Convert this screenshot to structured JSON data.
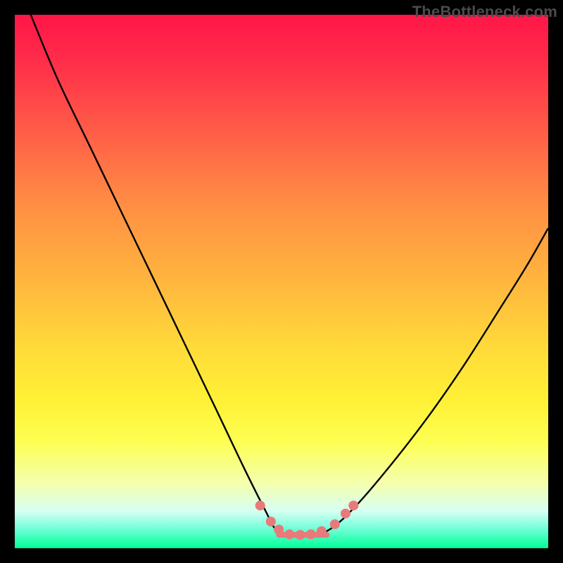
{
  "watermark": "TheBottleneck.com",
  "chart_data": {
    "type": "line",
    "title": "",
    "xlabel": "",
    "ylabel": "",
    "xlim": [
      0,
      100
    ],
    "ylim": [
      0,
      100
    ],
    "grid": false,
    "series": [
      {
        "name": "curve",
        "color": "#000000",
        "x": [
          3.0,
          8.0,
          14.0,
          20.0,
          26.0,
          32.0,
          38.0,
          43.0,
          47.0,
          49.0,
          52.0,
          55.0,
          59.0,
          64.0,
          70.0,
          77.0,
          84.0,
          91.0,
          96.0,
          100.0
        ],
        "values": [
          100,
          88.0,
          75.5,
          63.0,
          50.5,
          38.0,
          25.5,
          15.0,
          7.0,
          3.5,
          2.5,
          2.5,
          3.5,
          8.0,
          15.0,
          24.0,
          34.0,
          45.0,
          53.0,
          60.0
        ]
      }
    ],
    "markers": {
      "name": "bottom-dots",
      "color": "#e97a7a",
      "points": [
        {
          "x": 46.0,
          "y": 8.0
        },
        {
          "x": 48.0,
          "y": 5.0
        },
        {
          "x": 49.5,
          "y": 3.5
        },
        {
          "x": 51.5,
          "y": 2.6
        },
        {
          "x": 53.5,
          "y": 2.5
        },
        {
          "x": 55.5,
          "y": 2.6
        },
        {
          "x": 57.5,
          "y": 3.2
        },
        {
          "x": 60.0,
          "y": 4.5
        },
        {
          "x": 62.0,
          "y": 6.5
        },
        {
          "x": 63.5,
          "y": 8.0
        }
      ]
    },
    "rail": {
      "name": "bottom-rail",
      "color": "#e97a7a",
      "x_start": 49.5,
      "x_end": 58.5,
      "y": 2.5
    }
  }
}
